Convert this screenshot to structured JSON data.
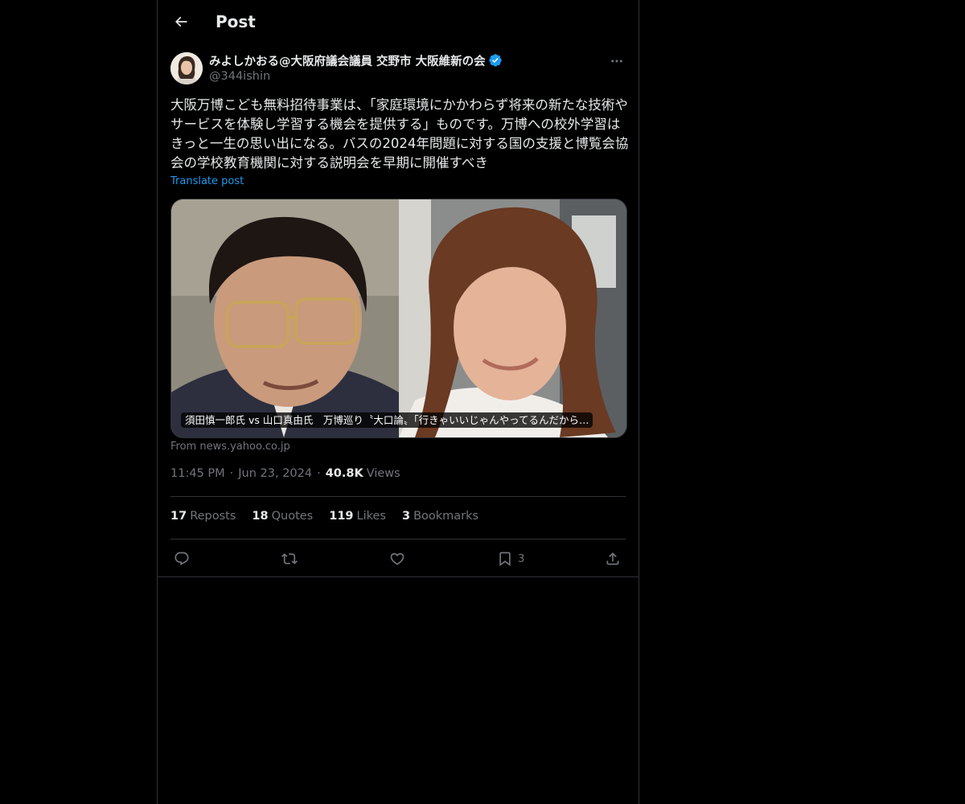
{
  "header": {
    "title": "Post",
    "back_icon": "arrow-left-icon"
  },
  "author": {
    "display_name": "みよしかおる@大阪府議会議員 交野市 大阪維新の会",
    "handle": "@344ishin",
    "verified": true,
    "verified_color": "#1d9bf0"
  },
  "post": {
    "text": "大阪万博こども無料招待事業は、「家庭環境にかかわらず将来の新たな技術やサービスを体験し学習する機会を提供する」ものです。万博への校外学習はきっと一生の思い出になる。バスの2024年問題に対する国の支援と博覧会協会の学校教育機関に対する説明会を早期に開催すべき",
    "translate_label": "Translate post",
    "time": "11:45 PM",
    "date": "Jun 23, 2024",
    "views_count": "40.8K",
    "views_label": "Views"
  },
  "media": {
    "caption": "須田慎一郎氏 vs 山口真由氏　万博巡り〝大口論〟「行きゃいいじゃんやってるんだから…",
    "source": "From news.yahoo.co.jp"
  },
  "stats": [
    {
      "count": "17",
      "label": "Reposts"
    },
    {
      "count": "18",
      "label": "Quotes"
    },
    {
      "count": "119",
      "label": "Likes"
    },
    {
      "count": "3",
      "label": "Bookmarks"
    }
  ],
  "actions": {
    "bookmark_count": "3"
  },
  "colors": {
    "background": "#000000",
    "text": "#e7e9ea",
    "muted": "#71767b",
    "accent": "#1d9bf0",
    "border": "#2f3336"
  }
}
